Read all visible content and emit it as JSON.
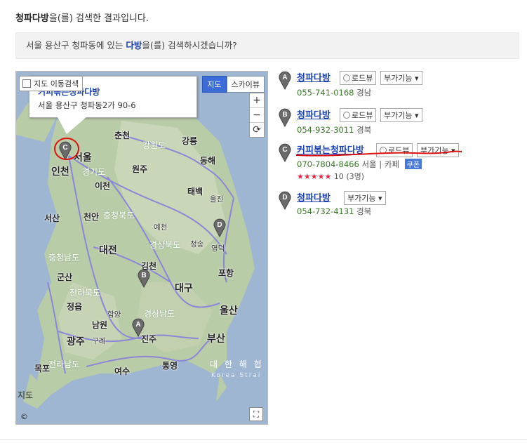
{
  "heading": {
    "keyword": "청파다방",
    "suffix": "을(를) 검색한 결과입니다."
  },
  "suggest": {
    "prefix": "서울 용산구 청파동에 있는 ",
    "keyword": "다방",
    "suffix": "을(를) 검색하시겠습니까?"
  },
  "map": {
    "move_search_label": "지도 이동검색",
    "popup_title": "커피볶는청파다방",
    "popup_address": "서울 용산구 청파동2가 90-6",
    "maptype_map": "지도",
    "maptype_sky": "스카이뷰",
    "zoom_in": "+",
    "zoom_out": "−",
    "reset": "⟳",
    "expand": "⛶",
    "copyright": "©",
    "cities": {
      "chuncheon": "춘천",
      "gangneung": "강릉",
      "seoul": "서울",
      "incheon": "인천",
      "wonju": "원주",
      "donghae": "동해",
      "icheon": "이천",
      "taebaek": "태백",
      "uljin": "울진",
      "seosan": "서산",
      "cheonan": "천안",
      "yecheon": "예천",
      "cheongsong": "청송",
      "yeongdeok": "영덕",
      "daejeon": "대전",
      "pohang": "포항",
      "gunsan": "군산",
      "gimcheon": "김천",
      "daegu": "대구",
      "jeongeup": "정읍",
      "ulsan": "울산",
      "hamyang": "함양",
      "namwon": "남원",
      "busan": "부산",
      "gwangju": "광주",
      "gurye": "구례",
      "jinju": "진주",
      "mokpo": "목포",
      "yeosu": "여수",
      "tongyeong": "통영"
    },
    "regions": {
      "gangwon": "강원도",
      "gyeonggi": "경기도",
      "chungbuk": "충청북도",
      "chungnam": "충청남도",
      "gyeongbuk": "경상북도",
      "jeonbuk": "전라북도",
      "gyeongnam": "경상남도",
      "jeonnam": "전라남도",
      "jido": "지도"
    },
    "sea_kr": "대 한 해 협",
    "sea_en": "Korea Strai",
    "markers": [
      "A",
      "B",
      "C",
      "D"
    ]
  },
  "results": [
    {
      "letter": "A",
      "name": "청파다방",
      "roadview": "로드뷰",
      "more": "부가기능",
      "phone": "055-741-0168",
      "region": "경남"
    },
    {
      "letter": "B",
      "name": "청파다방",
      "roadview": "로드뷰",
      "more": "부가기능",
      "phone": "054-932-3011",
      "region": "경북"
    },
    {
      "letter": "C",
      "name": "커피볶는청파다방",
      "roadview": "로드뷰",
      "more": "부가기능",
      "phone": "070-7804-8466",
      "region": "서울",
      "category": "카페",
      "coupon": "쿠폰",
      "stars": "★★★★★",
      "score": "10",
      "count": "(3명)"
    },
    {
      "letter": "D",
      "name": "청파다방",
      "more": "부가기능",
      "phone": "054-732-4131",
      "region": "경북"
    }
  ],
  "colors": {
    "link": "#1a3fb0",
    "phone": "#3a7a2a",
    "annotation": "#d11"
  }
}
